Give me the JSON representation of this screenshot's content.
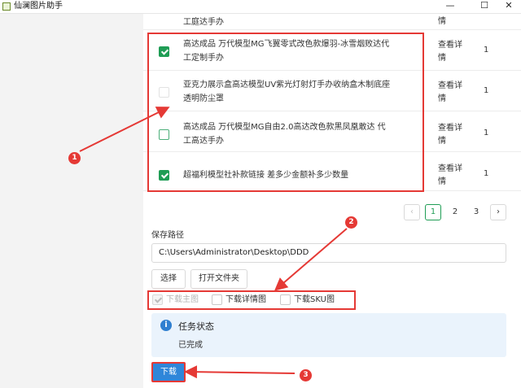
{
  "window": {
    "title": "仙澜图片助手",
    "minimize": "—",
    "maximize": "☐",
    "close": "✕"
  },
  "products": {
    "partial_row": {
      "name": "工庭达手办",
      "detail": "情"
    },
    "rows": [
      {
        "checked": true,
        "style": "checked",
        "name_line1": "高达成品 万代模型MG飞翼零式改色款爆羽-冰雪烟败达代",
        "name_line2": "工定制手办",
        "detail_line1": "查看详",
        "detail_line2": "情",
        "qty": "1"
      },
      {
        "checked": false,
        "style": "empty",
        "name_line1": "亚克力展示盒高达模型UV紫光灯射灯手办收纳盒木制底座",
        "name_line2": "透明防尘罩",
        "detail_line1": "查看详",
        "detail_line2": "情",
        "qty": "1"
      },
      {
        "checked": false,
        "style": "green",
        "name_line1": "高达成品 万代模型MG自由2.0高达改色款黑凤凰敢达 代",
        "name_line2": "工高达手办",
        "detail_line1": "查看详",
        "detail_line2": "情",
        "qty": "1"
      },
      {
        "checked": true,
        "style": "checked",
        "name_line1": "超福利模型社补款链接 差多少金额补多少数量",
        "name_line2": "",
        "detail_line1": "查看详",
        "detail_line2": "情",
        "qty": "1"
      }
    ]
  },
  "pagination": {
    "prev": "‹",
    "pages": [
      "1",
      "2",
      "3"
    ],
    "current": "1",
    "next": "›"
  },
  "save": {
    "label": "保存路径",
    "path": "C:\\Users\\Administrator\\Desktop\\DDD",
    "choose_button": "选择",
    "open_folder_button": "打开文件夹"
  },
  "options": {
    "main_image": {
      "label": "下载主图",
      "checked": true,
      "disabled": true
    },
    "detail_image": {
      "label": "下载详情图",
      "checked": false
    },
    "sku_image": {
      "label": "下载SKU图",
      "checked": false
    }
  },
  "task": {
    "icon": "info-icon",
    "title": "任务状态",
    "status": "已完成"
  },
  "download_button": "下载",
  "annotations": {
    "marker1": "1",
    "marker2": "2",
    "marker3": "3",
    "color": "#e53935"
  },
  "colors": {
    "accent_green": "#1f9d55",
    "primary_blue": "#2f86d9",
    "alert_bg": "#eaf3fc"
  }
}
